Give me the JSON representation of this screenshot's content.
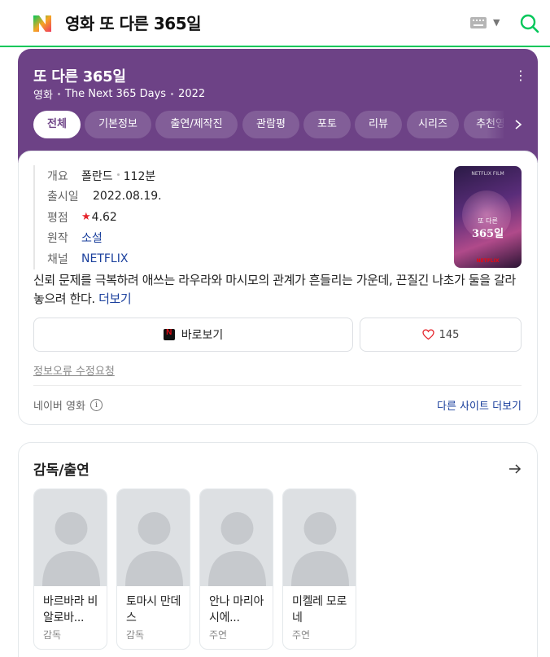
{
  "search": {
    "query": "영화 또 다른 365일",
    "logo_icon": "naver-n-logo-icon",
    "keyboard_icon": "keyboard-icon",
    "search_icon": "search-icon",
    "accent_color": "#03c75a"
  },
  "header": {
    "title": "또 다른 365일",
    "genre": "영화",
    "original_title": "The Next 365 Days",
    "year": "2022",
    "bg_color": "#6d4286",
    "tabs": [
      {
        "label": "전체",
        "active": true
      },
      {
        "label": "기본정보",
        "active": false
      },
      {
        "label": "출연/제작진",
        "active": false
      },
      {
        "label": "관람평",
        "active": false
      },
      {
        "label": "포토",
        "active": false
      },
      {
        "label": "리뷰",
        "active": false
      },
      {
        "label": "시리즈",
        "active": false
      },
      {
        "label": "추천영화",
        "active": false
      }
    ]
  },
  "info": {
    "overview_label": "개요",
    "country": "폴란드",
    "runtime": "112분",
    "release_label": "출시일",
    "release_date": "2022.08.19.",
    "rating_label": "평점",
    "rating": "4.62",
    "original_label": "원작",
    "original_work": "소설",
    "channel_label": "채널",
    "channel": "NETFLIX",
    "poster": {
      "top_text": "NETFLIX FILM",
      "title_small": "또 다른",
      "title_big": "365일",
      "brand": "NETFLIX"
    },
    "synopsis": "신뢰 문제를 극복하려 애쓰는 라우라와 마시모의 관계가 흔들리는 가운데, 끈질긴 나초가 둘을 갈라놓으려 한다.",
    "more_label": "더보기",
    "watch_label": "바로보기",
    "like_count": "145",
    "report_label": "정보오류 수정요청",
    "source_label": "네이버 영화",
    "other_sites_label": "다른 사이트 더보기"
  },
  "cast": {
    "title": "감독/출연",
    "people": [
      {
        "name": "바르바라 비알로바...",
        "role": "감독"
      },
      {
        "name": "토마시 만데스",
        "role": "감독"
      },
      {
        "name": "안나 마리아 시에...",
        "role": "주연"
      },
      {
        "name": "미켈레 모로네",
        "role": "주연"
      }
    ]
  }
}
